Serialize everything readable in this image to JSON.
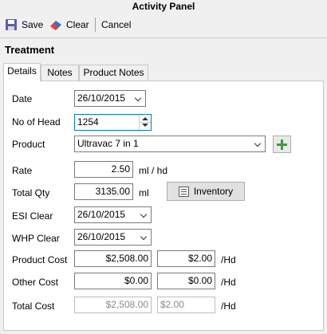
{
  "window": {
    "title": "Activity Panel"
  },
  "toolbar": {
    "save_label": "Save",
    "clear_label": "Clear",
    "cancel_label": "Cancel"
  },
  "section": {
    "title": "Treatment"
  },
  "tabs": [
    {
      "label": "Details",
      "active": true
    },
    {
      "label": "Notes",
      "active": false
    },
    {
      "label": "Product Notes",
      "active": false
    }
  ],
  "form": {
    "date": {
      "label": "Date",
      "value": "26/10/2015"
    },
    "no_of_head": {
      "label": "No of Head",
      "value": "1254"
    },
    "product": {
      "label": "Product",
      "value": "Ultravac 7 in 1"
    },
    "rate": {
      "label": "Rate",
      "value": "2.50",
      "unit": "ml / hd"
    },
    "total_qty": {
      "label": "Total Qty",
      "value": "3135.00",
      "unit": "ml"
    },
    "inventory_button": "Inventory",
    "esi_clear": {
      "label": "ESI Clear",
      "value": "26/10/2015"
    },
    "whp_clear": {
      "label": "WHP Clear",
      "value": "26/10/2015"
    },
    "product_cost": {
      "label": "Product Cost",
      "value": "$2,508.00",
      "per_head": "$2.00",
      "unit": "/Hd"
    },
    "other_cost": {
      "label": "Other Cost",
      "value": "$0.00",
      "per_head": "$0.00",
      "unit": "/Hd"
    },
    "total_cost": {
      "label": "Total Cost",
      "value": "$2,508.00",
      "per_head": "$2.00",
      "unit": "/Hd"
    }
  },
  "colors": {
    "accent": "#0078d7",
    "add_green": "#3c9d3c"
  }
}
